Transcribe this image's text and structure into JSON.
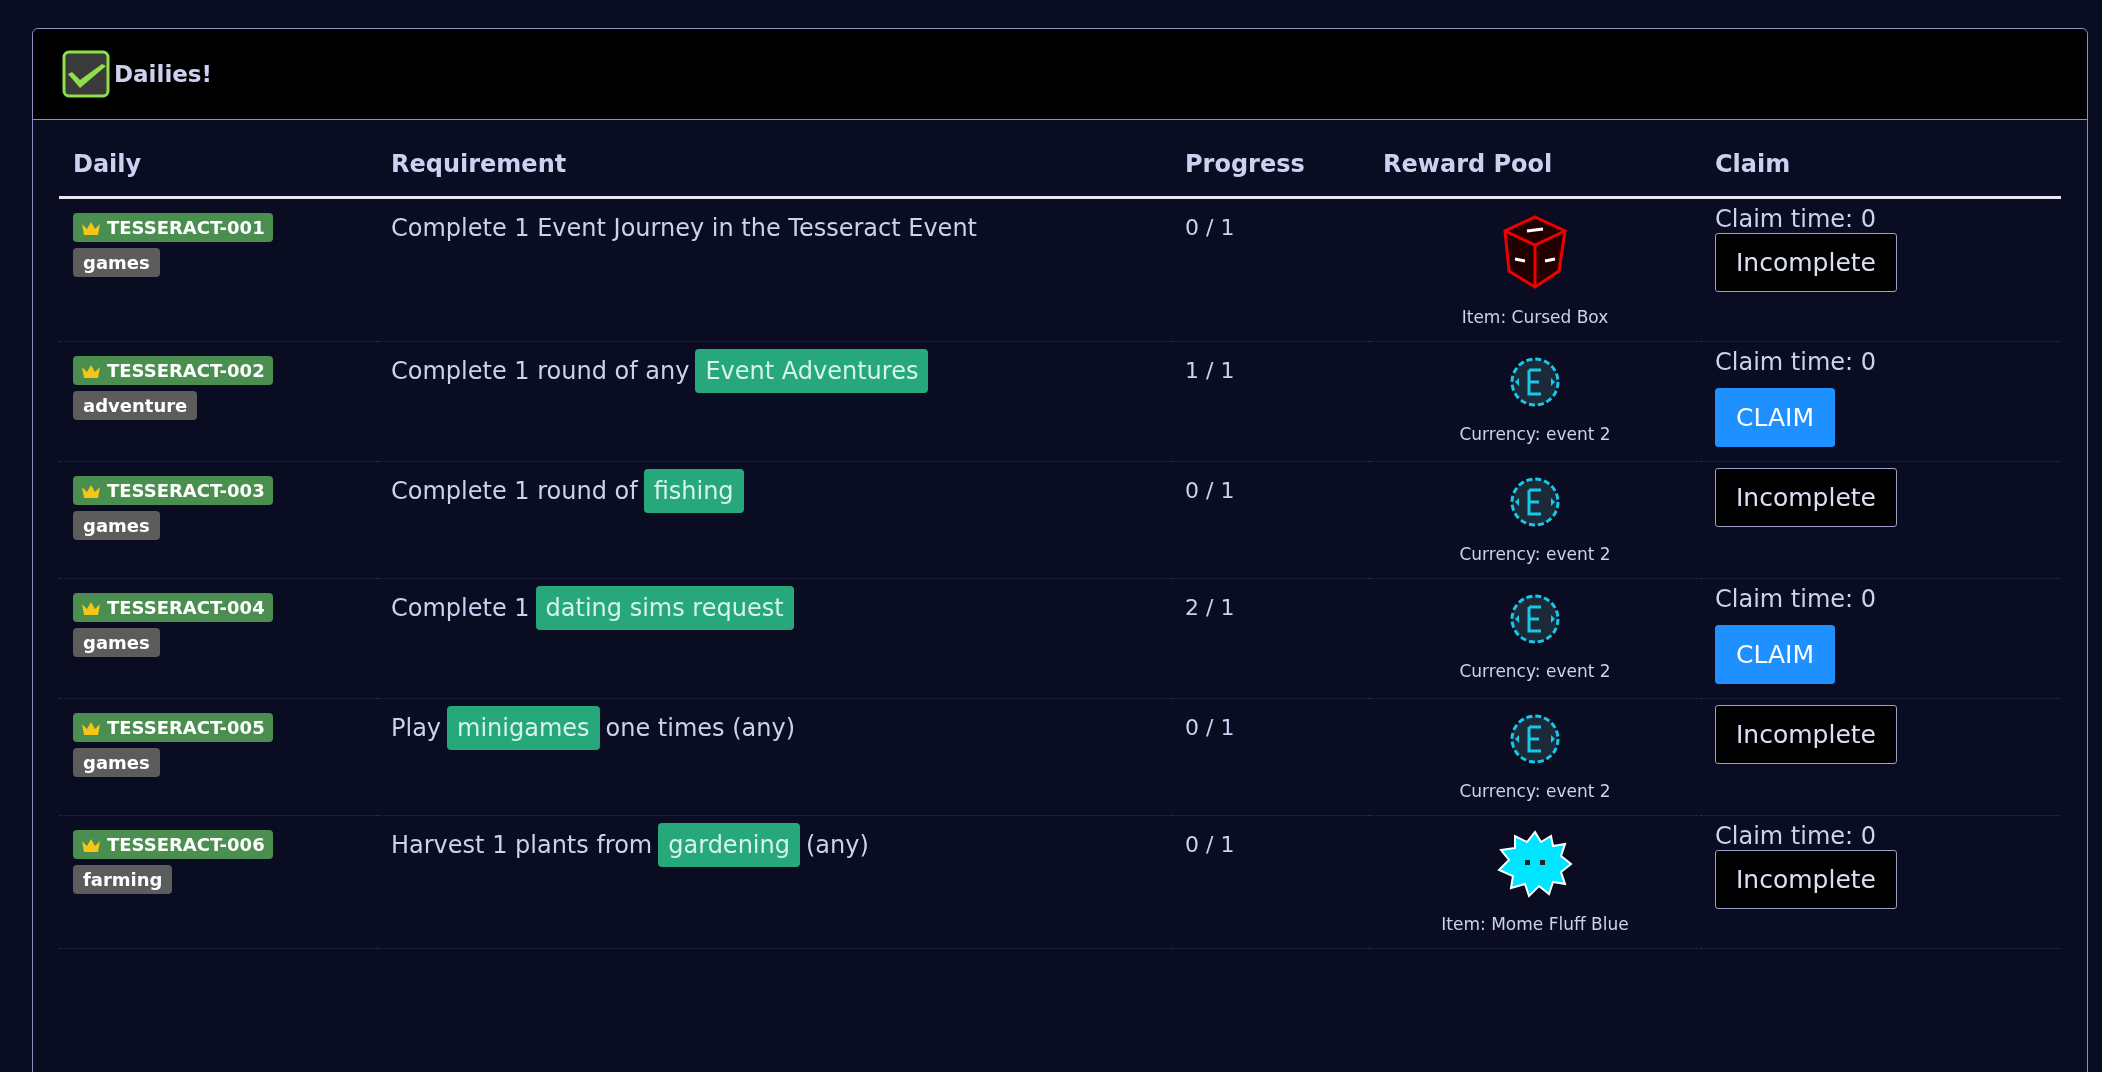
{
  "panel": {
    "title": "Dailies!"
  },
  "table": {
    "columns": [
      "Daily",
      "Requirement",
      "Progress",
      "Reward Pool",
      "Claim"
    ],
    "rows": [
      {
        "code": "TESSERACT-001",
        "category": "games",
        "requirement": [
          {
            "kind": "text",
            "text": "Complete 1 Event Journey in the Tesseract Event"
          }
        ],
        "progress": "0 / 1",
        "reward": {
          "kind": "cursed-box",
          "caption": "Item: Cursed Box"
        },
        "claim_time": "Claim time: 0",
        "button": {
          "kind": "incomplete",
          "label": "Incomplete"
        }
      },
      {
        "code": "TESSERACT-002",
        "category": "adventure",
        "requirement": [
          {
            "kind": "text",
            "text": "Complete 1 round of any"
          },
          {
            "kind": "link",
            "text": "Event Adventures"
          }
        ],
        "progress": "1 / 1",
        "reward": {
          "kind": "event-currency",
          "caption": "Currency: event 2"
        },
        "claim_time": "Claim time: 0",
        "button": {
          "kind": "claim",
          "label": "CLAIM"
        }
      },
      {
        "code": "TESSERACT-003",
        "category": "games",
        "requirement": [
          {
            "kind": "text",
            "text": "Complete 1 round of"
          },
          {
            "kind": "link",
            "text": "fishing"
          }
        ],
        "progress": "0 / 1",
        "reward": {
          "kind": "event-currency",
          "caption": "Currency: event 2"
        },
        "button": {
          "kind": "incomplete",
          "label": "Incomplete"
        }
      },
      {
        "code": "TESSERACT-004",
        "category": "games",
        "requirement": [
          {
            "kind": "text",
            "text": "Complete 1"
          },
          {
            "kind": "link",
            "text": "dating sims request"
          }
        ],
        "progress": "2 / 1",
        "reward": {
          "kind": "event-currency",
          "caption": "Currency: event 2"
        },
        "claim_time": "Claim time: 0",
        "button": {
          "kind": "claim",
          "label": "CLAIM"
        }
      },
      {
        "code": "TESSERACT-005",
        "category": "games",
        "requirement": [
          {
            "kind": "text",
            "text": "Play"
          },
          {
            "kind": "link",
            "text": "minigames"
          },
          {
            "kind": "text",
            "text": "one times (any)"
          }
        ],
        "progress": "0 / 1",
        "reward": {
          "kind": "event-currency",
          "caption": "Currency: event 2"
        },
        "button": {
          "kind": "incomplete",
          "label": "Incomplete"
        }
      },
      {
        "code": "TESSERACT-006",
        "category": "farming",
        "requirement": [
          {
            "kind": "text",
            "text": "Harvest 1 plants from"
          },
          {
            "kind": "link",
            "text": "gardening"
          },
          {
            "kind": "text",
            "text": "(any)"
          }
        ],
        "progress": "0 / 1",
        "reward": {
          "kind": "fluff",
          "caption": "Item: Mome Fluff Blue"
        },
        "claim_time": "Claim time: 0",
        "button": {
          "kind": "incomplete",
          "label": "Incomplete"
        }
      }
    ]
  }
}
